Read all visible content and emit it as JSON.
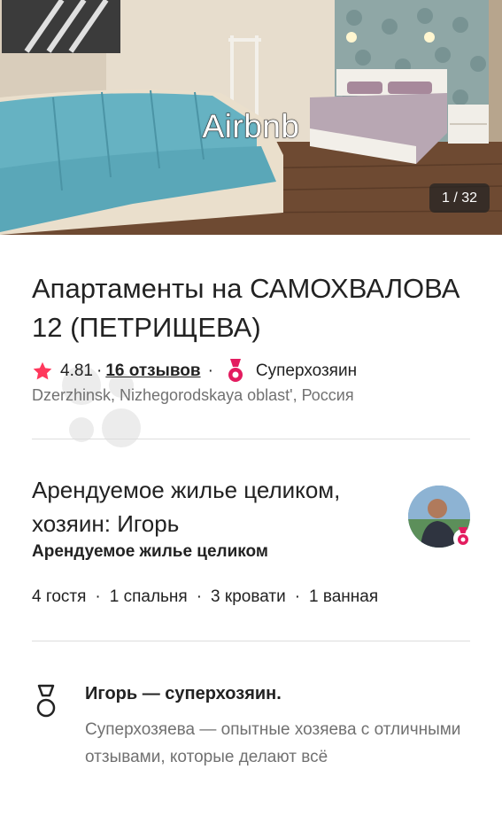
{
  "photo": {
    "brand_label": "Airbnb",
    "counter": "1 / 32"
  },
  "listing": {
    "title": "Апартаменты на САМОХВАЛОВА 12 (ПЕТРИЩЕВА)",
    "rating": "4.81",
    "separator": "·",
    "reviews_link": "16 отзывов",
    "superhost_label": "Суперхозяин",
    "location": "Dzerzhinsk, Nizhegorodskaya oblast', Россия"
  },
  "host": {
    "title": "Арендуемое жилье целиком, хозяин: Игорь",
    "subtitle": "Арендуемое жилье целиком",
    "specs": [
      "4 гостя",
      "1 спальня",
      "3 кровати",
      "1 ванная"
    ]
  },
  "superhost": {
    "title": "Игорь — суперхозяин.",
    "text": "Суперхозяева — опытные хозяева с отличными отзывами, которые делают всё"
  },
  "icons": {
    "rating": "star-icon",
    "superhost": "medal-icon"
  },
  "colors": {
    "accent": "#FF385C",
    "text": "#222222",
    "muted": "#717171"
  }
}
